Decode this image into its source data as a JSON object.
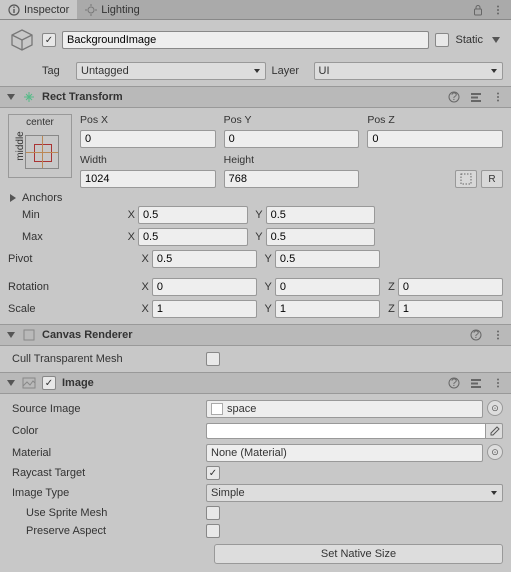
{
  "tabs": {
    "inspector": "Inspector",
    "lighting": "Lighting"
  },
  "object": {
    "name": "BackgroundImage",
    "static_label": "Static"
  },
  "tag_layer": {
    "tag_label": "Tag",
    "tag_value": "Untagged",
    "layer_label": "Layer",
    "layer_value": "UI"
  },
  "rect_transform": {
    "title": "Rect Transform",
    "widget": {
      "h": "center",
      "v": "middle"
    },
    "labels": {
      "posx": "Pos X",
      "posy": "Pos Y",
      "posz": "Pos Z",
      "width": "Width",
      "height": "Height"
    },
    "posx": "0",
    "posy": "0",
    "posz": "0",
    "width": "1024",
    "height": "768",
    "blueprint_r": "R",
    "anchors_label": "Anchors",
    "min_label": "Min",
    "max_label": "Max",
    "pivot_label": "Pivot",
    "rotation_label": "Rotation",
    "scale_label": "Scale",
    "axes": {
      "x": "X",
      "y": "Y",
      "z": "Z"
    },
    "anchors_min_x": "0.5",
    "anchors_min_y": "0.5",
    "anchors_max_x": "0.5",
    "anchors_max_y": "0.5",
    "pivot_x": "0.5",
    "pivot_y": "0.5",
    "rot_x": "0",
    "rot_y": "0",
    "rot_z": "0",
    "scale_x": "1",
    "scale_y": "1",
    "scale_z": "1"
  },
  "canvas_renderer": {
    "title": "Canvas Renderer",
    "cull_label": "Cull Transparent Mesh"
  },
  "image": {
    "title": "Image",
    "source_label": "Source Image",
    "source_value": "space",
    "color_label": "Color",
    "color_value": "#ffffff",
    "material_label": "Material",
    "material_value": "None (Material)",
    "raycast_label": "Raycast Target",
    "image_type_label": "Image Type",
    "image_type_value": "Simple",
    "use_sprite_mesh_label": "Use Sprite Mesh",
    "preserve_aspect_label": "Preserve Aspect",
    "set_native_size": "Set Native Size"
  }
}
